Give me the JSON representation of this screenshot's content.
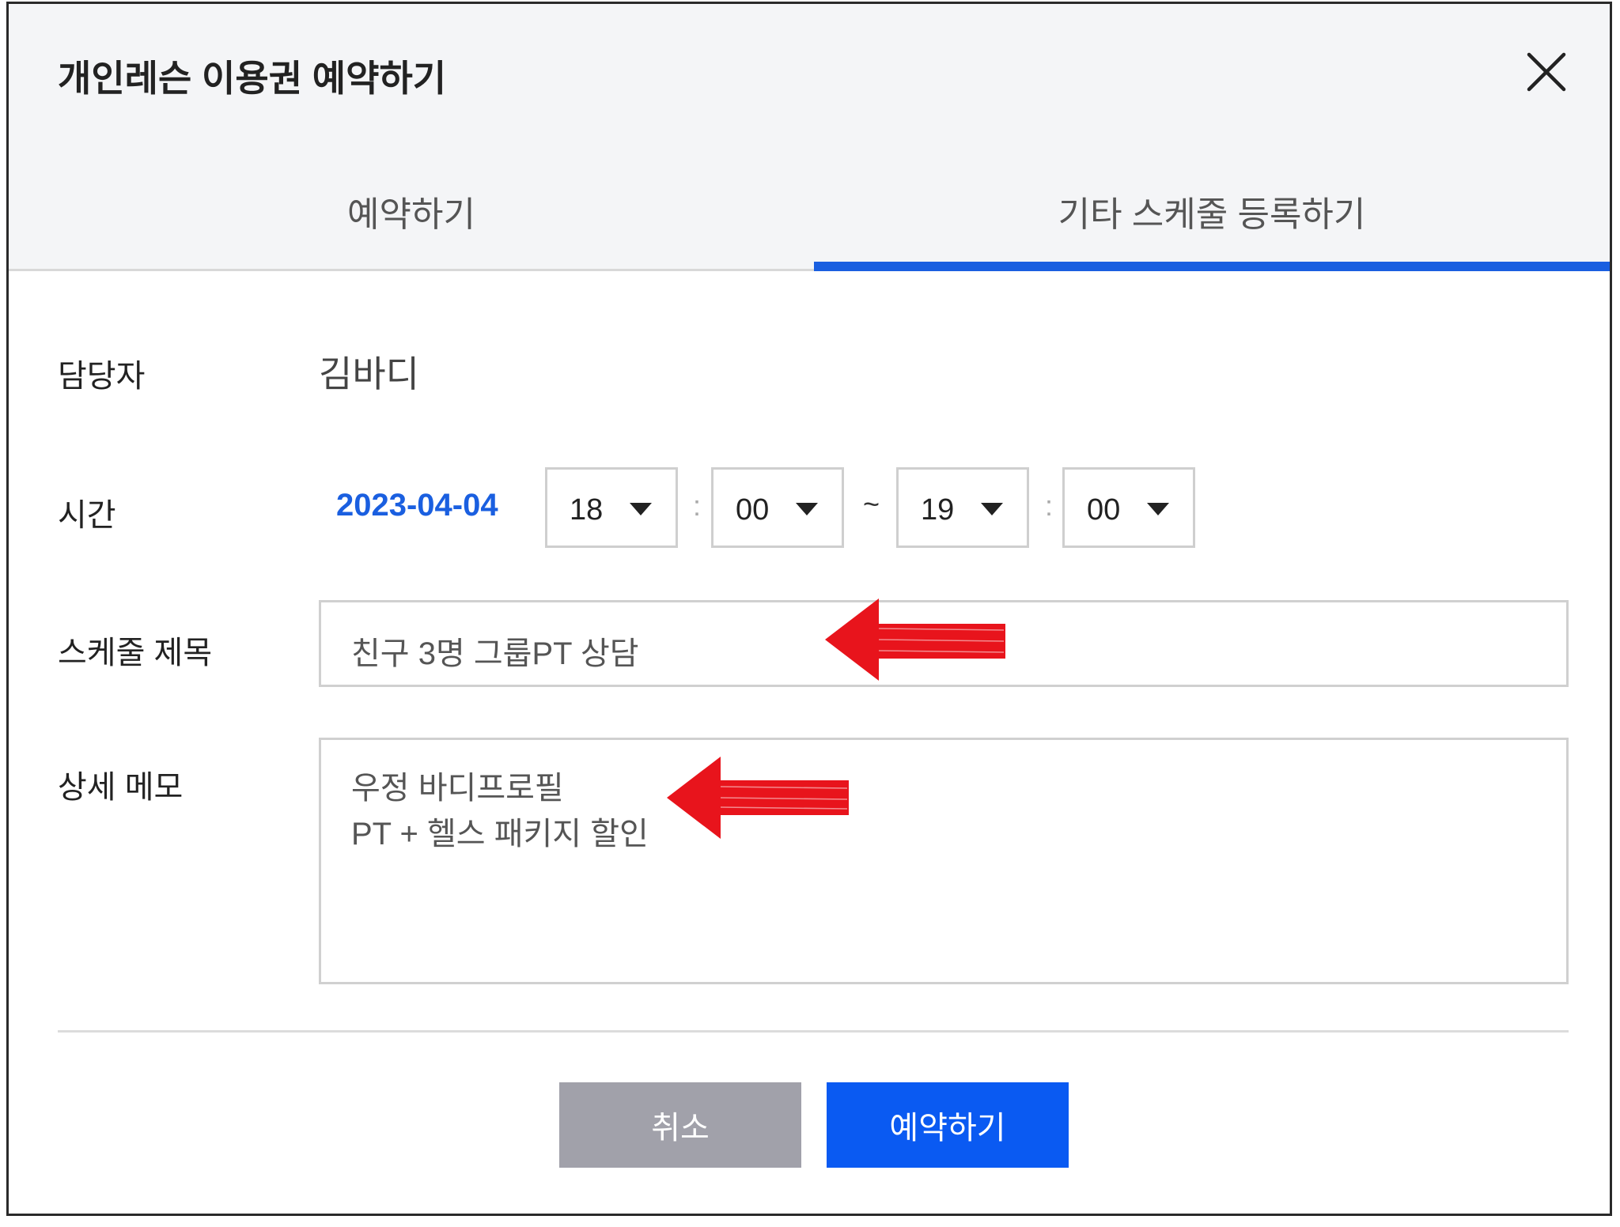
{
  "modal": {
    "title": "개인레슨 이용권 예약하기",
    "close_icon": "close-icon"
  },
  "tabs": [
    {
      "label": "예약하기",
      "active": false
    },
    {
      "label": "기타 스케줄 등록하기",
      "active": true
    }
  ],
  "form": {
    "manager_label": "담당자",
    "manager_value": "김바디",
    "time_label": "시간",
    "date": "2023-04-04",
    "start_hour": "18",
    "start_minute": "00",
    "end_hour": "19",
    "end_minute": "00",
    "time_colon": ":",
    "range_sep": "~",
    "title_label": "스케줄 제목",
    "title_value": "친구 3명 그룹PT 상담",
    "memo_label": "상세 메모",
    "memo_line1": "우정 바디프로필",
    "memo_line2": "PT + 헬스 패키지 할인"
  },
  "buttons": {
    "cancel": "취소",
    "submit": "예약하기"
  },
  "colors": {
    "accent": "#1a5fe0",
    "submit_bg": "#0a5af2",
    "cancel_bg": "#a1a1aa",
    "annotation_arrow": "#e8141c"
  }
}
